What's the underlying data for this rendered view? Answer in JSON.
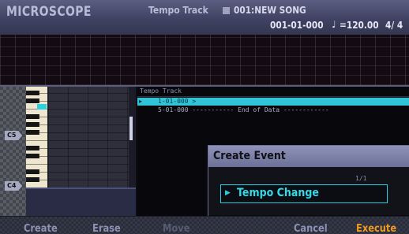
{
  "header": {
    "app_title": "MICROSCOPE",
    "mode": "Tempo Track",
    "song": "001:NEW SONG",
    "position": "001-01-000",
    "tempo": "=120.00",
    "time_signature": "4/ 4",
    "icons": [
      "song-icon",
      "quarter-note-icon"
    ]
  },
  "keyboard": {
    "octave_labels": [
      "C5",
      "C4"
    ]
  },
  "event_list": {
    "title": "Tempo Track",
    "rows": [
      {
        "text": "1-01-000 >",
        "selected": true
      },
      {
        "text": "5-01-000 ----------- End of Data ------------",
        "selected": false
      }
    ]
  },
  "dialog": {
    "title": "Create Event",
    "page": "1/1",
    "value": "Tempo Change"
  },
  "function_bar": {
    "create": "Create",
    "erase": "Erase",
    "move": "Move",
    "cancel": "Cancel",
    "execute": "Execute"
  },
  "colors": {
    "accent": "#30c4d6",
    "execute": "#ef9a1c",
    "header": "#4a4d6e"
  }
}
